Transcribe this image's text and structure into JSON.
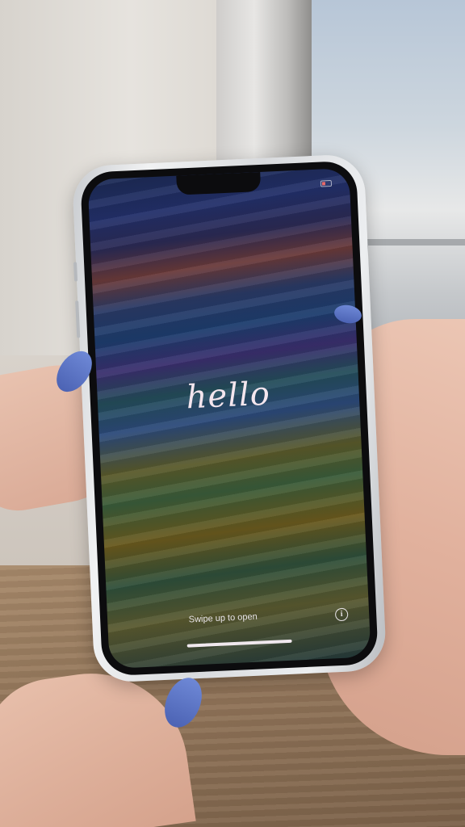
{
  "lock_screen": {
    "greeting": "hello",
    "swipe_prompt": "Swipe up to open",
    "info_glyph": "i",
    "icons": [
      "info-icon",
      "battery-icon"
    ]
  },
  "colors": {
    "nail_polish": "#5a73c8",
    "text": "#f4e6ee"
  }
}
